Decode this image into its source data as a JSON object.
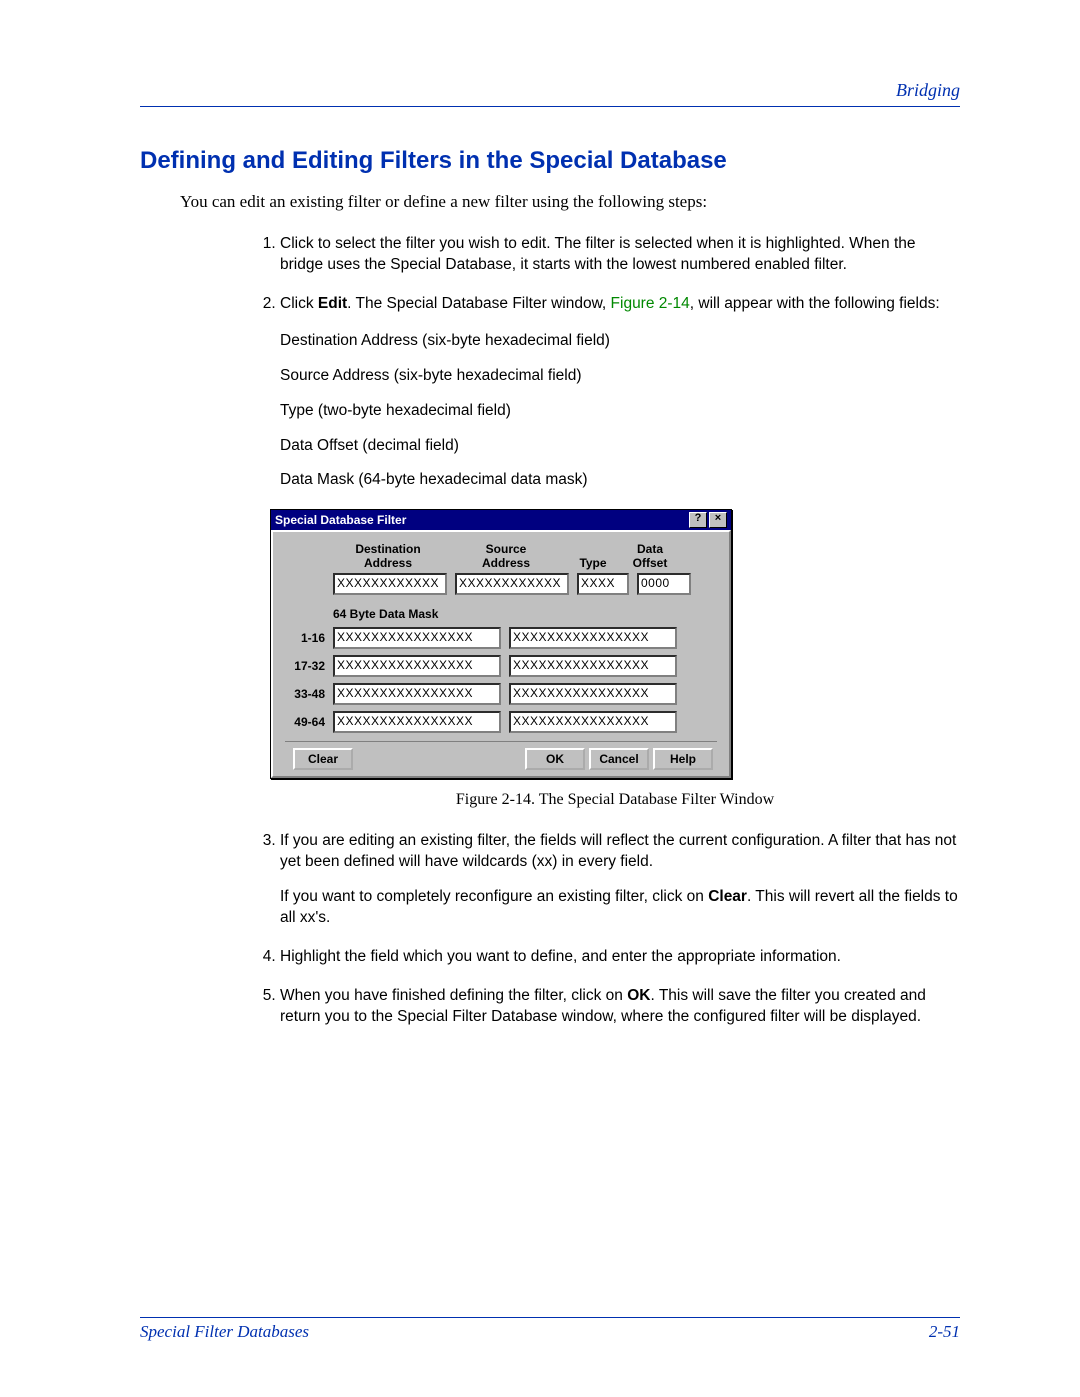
{
  "header": {
    "section": "Bridging"
  },
  "title": "Defining and Editing Filters in the Special Database",
  "intro": "You can edit an existing filter or define a new filter using the following steps:",
  "steps": {
    "s1": "Click to select the filter you wish to edit. The filter is selected when it is highlighted. When the bridge uses the Special Database, it starts with the lowest numbered enabled filter.",
    "s2a": "Click ",
    "s2b_bold": "Edit",
    "s2c": ". The Special Database Filter window, ",
    "s2d_link": "Figure 2-14",
    "s2e": ", will appear with the following fields:",
    "f_dest": "Destination Address (six-byte hexadecimal field)",
    "f_src": "Source Address (six-byte hexadecimal field)",
    "f_type": "Type (two-byte hexadecimal field)",
    "f_off": "Data Offset (decimal field)",
    "f_mask": "Data Mask (64-byte hexadecimal data mask)",
    "s3a": "If you are editing an existing filter, the fields will reflect the current configuration. A filter that has not yet been defined will have wildcards (xx) in every field.",
    "s3b_a": "If you want to completely reconfigure an existing filter, click on ",
    "s3b_bold": "Clear",
    "s3b_c": ". This will revert all the fields to all xx's.",
    "s4": "Highlight the field which you want to define, and enter the appropriate information.",
    "s5a": "When you have finished defining the filter, click on ",
    "s5_bold": "OK",
    "s5b": ". This will save the filter you created and return you to the Special Filter Database window, where the configured filter will be displayed."
  },
  "dialog": {
    "title": "Special Database Filter",
    "labels": {
      "dest1": "Destination",
      "dest2": "Address",
      "src1": "Source",
      "src2": "Address",
      "type": "Type",
      "off1": "Data",
      "off2": "Offset"
    },
    "values": {
      "dest": "XXXXXXXXXXXX",
      "src": "XXXXXXXXXXXX",
      "type": "XXXX",
      "off": "0000",
      "mask": "XXXXXXXXXXXXXXXX"
    },
    "masklabel": "64 Byte Data Mask",
    "rows": [
      "1-16",
      "17-32",
      "33-48",
      "49-64"
    ],
    "buttons": {
      "clear": "Clear",
      "ok": "OK",
      "cancel": "Cancel",
      "help": "Help"
    }
  },
  "caption": "Figure 2-14. The Special Database Filter Window",
  "footer": {
    "left": "Special Filter Databases",
    "right": "2-51"
  }
}
